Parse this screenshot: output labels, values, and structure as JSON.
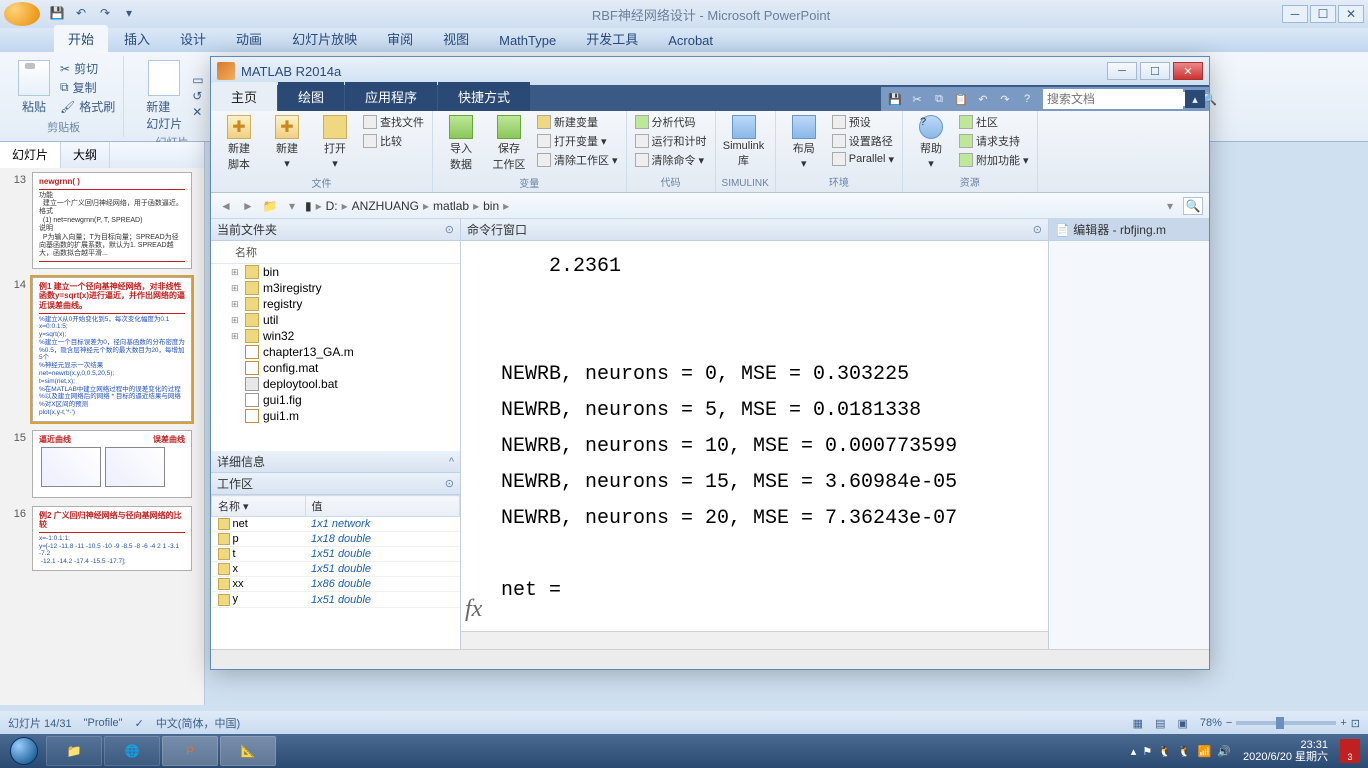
{
  "ppt": {
    "title": "RBF神经网络设计 - Microsoft PowerPoint",
    "tabs": [
      "开始",
      "插入",
      "设计",
      "动画",
      "幻灯片放映",
      "审阅",
      "视图",
      "MathType",
      "开发工具",
      "Acrobat"
    ],
    "clipboard": {
      "cut": "剪切",
      "copy": "复制",
      "fmt": "格式刷",
      "paste": "粘贴",
      "label": "剪贴板"
    },
    "slides_grp": {
      "new": "新建\n幻灯片",
      "label": "幻灯片"
    },
    "left_tabs": {
      "slides": "幻灯片",
      "outline": "大纲"
    },
    "thumbs": [
      {
        "n": "13",
        "title": "newgrnn( )",
        "body": "功能\n  建立一个广义回归神经网络，用于函数逼近。\n格式\n  (1) net=newgrnn(P, T, SPREAD)\n说明\n  P为输入向量；T为目标向量；SPREAD为径向基函数的扩展系数，默认为1. SPREAD越大，函数拟合越平滑..."
      },
      {
        "n": "14",
        "sel": true,
        "title": "例1 建立一个径向基神经网络，对非线性函数y=sqrt(x)进行逼近，并作出网络的逼近误差曲线。",
        "code": "%建立X从0开始变化到5，每次变化幅度为0.1\nx=0:0.1:5;\ny=sqrt(x);\n%建立一个目标误差为0，径向基函数的分布密度为\n%0.5，隐含层神经元个数的最大数目为20，每增加5个\n%神经元显示一次结果\nnet=newrb(x,y,0,0.5,20,5);\nt=sim(net,x);\n%在MATLAB中建立网络过程中的误差变化的过程\n%以及建立网络后的网络 * 目标的逼近结果与网络\n%对X区间的预测\nplot(x,y-t,'*-')"
      },
      {
        "n": "15",
        "title": "逼近曲线",
        "title2": "误差曲线"
      },
      {
        "n": "16",
        "title": "例2 广义回归神经网络与径向基网络的比较",
        "code": "x=-1:0.1:1;\ny=[-12 -11.8 -11 -10.5 -10 -9 -8.5 -8 -6 -4 2 1 -3.1 -7.2\n -12.1 -14.2 -17.4 -15.5 -17.7];"
      }
    ],
    "status": {
      "slide": "幻灯片 14/31",
      "profile": "\"Profile\"",
      "lang": "中文(简体，中国)",
      "zoom": "78%"
    }
  },
  "matlab": {
    "title": "MATLAB R2014a",
    "tabs": [
      "主页",
      "绘图",
      "应用程序",
      "快捷方式"
    ],
    "search_placeholder": "搜索文档",
    "ribbon": {
      "file": {
        "new_script": "新建\n脚本",
        "new": "新建",
        "open": "打开",
        "find": "查找文件",
        "compare": "比较",
        "label": "文件"
      },
      "var": {
        "import": "导入\n数据",
        "save_ws": "保存\n工作区",
        "new_var": "新建变量",
        "open_var": "打开变量",
        "clear_ws": "清除工作区",
        "label": "变量"
      },
      "code": {
        "analyze": "分析代码",
        "runtime": "运行和计时",
        "clear_cmd": "清除命令",
        "label": "代码"
      },
      "simulink": {
        "btn": "Simulink\n库",
        "label": "SIMULINK"
      },
      "env": {
        "layout": "布局",
        "prefs": "预设",
        "setpath": "设置路径",
        "parallel": "Parallel",
        "label": "环境"
      },
      "res": {
        "help": "帮助",
        "community": "社区",
        "support": "请求支持",
        "addons": "附加功能",
        "label": "资源"
      }
    },
    "addr": {
      "drive": "D:",
      "p1": "ANZHUANG",
      "p2": "matlab",
      "p3": "bin"
    },
    "curfolder": {
      "title": "当前文件夹",
      "name_col": "名称",
      "items": [
        {
          "t": "folder",
          "n": "bin"
        },
        {
          "t": "folder",
          "n": "m3iregistry"
        },
        {
          "t": "folder",
          "n": "registry"
        },
        {
          "t": "folder",
          "n": "util"
        },
        {
          "t": "folder",
          "n": "win32"
        },
        {
          "t": "m",
          "n": "chapter13_GA.m"
        },
        {
          "t": "mat",
          "n": "config.mat"
        },
        {
          "t": "bat",
          "n": "deploytool.bat"
        },
        {
          "t": "fig",
          "n": "gui1.fig"
        },
        {
          "t": "m",
          "n": "gui1.m"
        }
      ]
    },
    "details": "详细信息",
    "workspace": {
      "title": "工作区",
      "cols": {
        "name": "名称",
        "value": "值"
      },
      "vars": [
        {
          "n": "net",
          "v": "1x1 network"
        },
        {
          "n": "p",
          "v": "1x18 double"
        },
        {
          "n": "t",
          "v": "1x51 double"
        },
        {
          "n": "x",
          "v": "1x51 double"
        },
        {
          "n": "xx",
          "v": "1x86 double"
        },
        {
          "n": "y",
          "v": "1x51 double"
        }
      ]
    },
    "cmdwin": {
      "title": "命令行窗口",
      "text": "    2.2361\n\n\nNEWRB, neurons = 0, MSE = 0.303225\nNEWRB, neurons = 5, MSE = 0.0181338\nNEWRB, neurons = 10, MSE = 0.000773599\nNEWRB, neurons = 15, MSE = 3.60984e-05\nNEWRB, neurons = 20, MSE = 7.36243e-07\n\nnet =\n"
    },
    "editor": {
      "title": "编辑器 - rbfjing.m"
    }
  },
  "taskbar": {
    "time": "23:31",
    "date": "2020/6/20 星期六",
    "badge": "3"
  }
}
